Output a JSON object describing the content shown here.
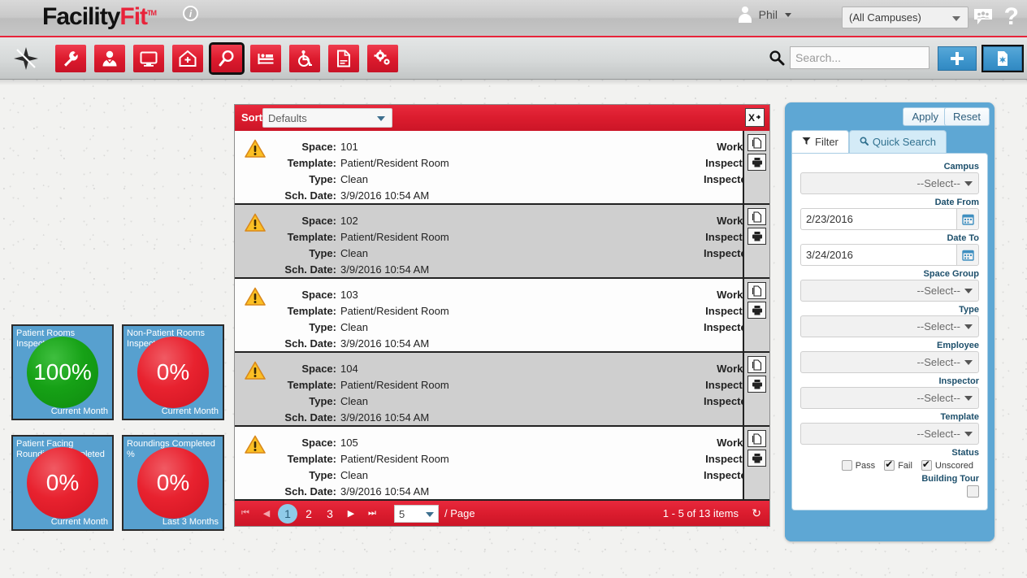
{
  "header": {
    "logo_main": "Facility",
    "logo_accent": "Fit",
    "logo_tm": "TM",
    "info_badge": "i",
    "user_name": "Phil",
    "campus_value": "(All Campuses)",
    "chat_icon": "chat-people-icon",
    "help_icon": "?"
  },
  "toolbar": {
    "compass_icon": "compass-star-icon",
    "items": [
      {
        "name": "wrench-icon",
        "label": "Maintenance"
      },
      {
        "name": "person-icon",
        "label": "Staff"
      },
      {
        "name": "monitor-icon",
        "label": "Display"
      },
      {
        "name": "home-plus-icon",
        "label": "Facility"
      },
      {
        "name": "magnifier-icon",
        "label": "Inspections"
      },
      {
        "name": "bed-icon",
        "label": "Beds"
      },
      {
        "name": "wheelchair-icon",
        "label": "Accessibility"
      },
      {
        "name": "document-icon",
        "label": "Reports"
      },
      {
        "name": "gears-icon",
        "label": "Settings"
      }
    ],
    "selected_index": 4,
    "search_placeholder": "Search...",
    "search_value": "",
    "add_label": "+",
    "doc_button": "new-document-icon"
  },
  "kpis": [
    {
      "title": "Patient Rooms Inspected %",
      "value": "100%",
      "color": "green",
      "period": "Current Month"
    },
    {
      "title": "Non-Patient Rooms Inspected %",
      "value": "0%",
      "color": "red",
      "period": "Current Month"
    },
    {
      "title": "Patient Facing Roundings Completed",
      "value": "0%",
      "color": "red",
      "period": "Current Month"
    },
    {
      "title": "Roundings Completed %",
      "value": "0%",
      "color": "red",
      "period": "Last 3 Months"
    }
  ],
  "list": {
    "sort_label": "Sort",
    "sort_value": "Defaults",
    "export_label": "X",
    "field_labels": {
      "space": "Space:",
      "template": "Template:",
      "type": "Type:",
      "sch_date": "Sch. Date:",
      "worker": "Worker:",
      "inspector": "Inspector:",
      "inspected": "Inspected:"
    },
    "rows": [
      {
        "status_icon": "warning-triangle-icon",
        "space": "101",
        "template": "Patient/Resident Room",
        "type": "Clean",
        "sch_date": "3/9/2016 10:54 AM",
        "worker": "",
        "inspector": "",
        "inspected": ""
      },
      {
        "status_icon": "warning-triangle-icon",
        "space": "102",
        "template": "Patient/Resident Room",
        "type": "Clean",
        "sch_date": "3/9/2016 10:54 AM",
        "worker": "",
        "inspector": "",
        "inspected": ""
      },
      {
        "status_icon": "warning-triangle-icon",
        "space": "103",
        "template": "Patient/Resident Room",
        "type": "Clean",
        "sch_date": "3/9/2016 10:54 AM",
        "worker": "",
        "inspector": "",
        "inspected": ""
      },
      {
        "status_icon": "warning-triangle-icon",
        "space": "104",
        "template": "Patient/Resident Room",
        "type": "Clean",
        "sch_date": "3/9/2016 10:54 AM",
        "worker": "",
        "inspector": "",
        "inspected": ""
      },
      {
        "status_icon": "warning-triangle-icon",
        "space": "105",
        "template": "Patient/Resident Room",
        "type": "Clean",
        "sch_date": "3/9/2016 10:54 AM",
        "worker": "",
        "inspector": "",
        "inspected": ""
      }
    ],
    "pager": {
      "first": "⏮",
      "prev": "◀",
      "pages": [
        "1",
        "2",
        "3"
      ],
      "active_page": "1",
      "next": "▶",
      "last": "⏭",
      "page_size": "5",
      "per_page_label": "/ Page",
      "item_count": "1 - 5 of 13 items",
      "refresh_icon": "↻"
    }
  },
  "filter": {
    "apply_label": "Apply",
    "reset_label": "Reset",
    "tabs": [
      {
        "label": "Filter",
        "icon": "funnel-icon",
        "active": true
      },
      {
        "label": "Quick Search",
        "icon": "search-icon",
        "active": false
      }
    ],
    "fields": [
      {
        "label": "Campus",
        "value": "--Select--",
        "kind": "select"
      },
      {
        "label": "Date From",
        "value": "2/23/2016",
        "kind": "date"
      },
      {
        "label": "Date To",
        "value": "3/24/2016",
        "kind": "date"
      },
      {
        "label": "Space Group",
        "value": "--Select--",
        "kind": "select"
      },
      {
        "label": "Type",
        "value": "--Select--",
        "kind": "select"
      },
      {
        "label": "Employee",
        "value": "--Select--",
        "kind": "select"
      },
      {
        "label": "Inspector",
        "value": "--Select--",
        "kind": "select"
      },
      {
        "label": "Template",
        "value": "--Select--",
        "kind": "select"
      }
    ],
    "status_label": "Status",
    "status_options": [
      {
        "label": "Pass",
        "checked": false
      },
      {
        "label": "Fail",
        "checked": true
      },
      {
        "label": "Unscored",
        "checked": true
      }
    ],
    "building_tour_label": "Building Tour",
    "building_tour_checked": false
  },
  "colors": {
    "brand_red": "#db1c2e",
    "panel_blue": "#5ea7d4",
    "kpi_green": "#16a116",
    "kpi_red": "#e8222f",
    "accent_blue": "#3f96cd"
  }
}
